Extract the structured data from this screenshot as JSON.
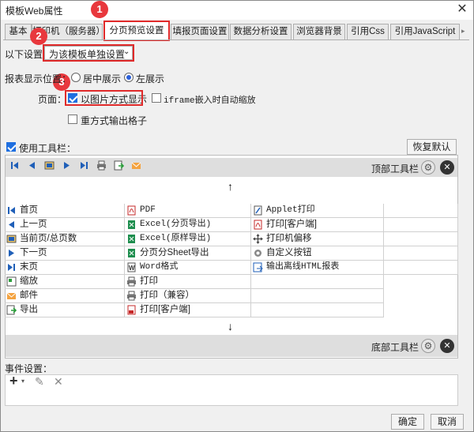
{
  "window": {
    "title": "模板Web属性"
  },
  "tabs": [
    "基本",
    "打印机（服务器）",
    "分页预览设置",
    "填报页面设置",
    "数据分析设置",
    "浏览器背景",
    "引用Css",
    "引用JavaScript"
  ],
  "badges": [
    "1",
    "2",
    "3"
  ],
  "settings": {
    "mode_label": "以下设置：",
    "mode_value": "为该模板单独设置",
    "position_label": "报表显示位置：",
    "center_option": "居中展示",
    "left_option": "左展示",
    "page_label": "页面：",
    "image_option": "以图片方式显示",
    "iframe_option": "iframe嵌入时自动缩放",
    "repeat_option": "重方式输出格子",
    "toolbar_label": "使用工具栏：",
    "reset_button": "恢复默认"
  },
  "toolbar_panel": {
    "top_label": "顶部工具栏",
    "bottom_label": "底部工具栏",
    "up_arrow": "↑",
    "down_arrow": "↓"
  },
  "buttons_col1": [
    "首页",
    "上一页",
    "当前页/总页数",
    "下一页",
    "末页",
    "缩放",
    "邮件",
    "导出"
  ],
  "buttons_col2": [
    "PDF",
    "Excel(分页导出)",
    "Excel(原样导出)",
    "分页分Sheet导出",
    "Word格式",
    "打印",
    "打印（兼容）",
    "打印[客户端]"
  ],
  "buttons_col3": [
    "Applet打印",
    "打印[客户端]",
    "打印机偏移",
    "自定义按钮",
    "输出离线HTML报表"
  ],
  "events": {
    "label": "事件设置：",
    "add": "+",
    "edit": "✎",
    "delete": "✕"
  },
  "footer": {
    "ok": "确定",
    "cancel": "取消"
  },
  "colors": {
    "accent": "#1f6fe0",
    "highlight": "#e02a2a",
    "badge": "#e8383d",
    "bar": "#dedede"
  }
}
